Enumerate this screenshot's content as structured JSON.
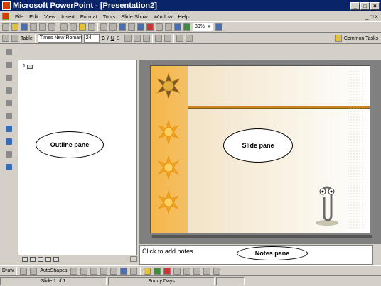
{
  "window": {
    "title": "Microsoft PowerPoint - [Presentation2]",
    "buttons": [
      "_",
      "□",
      "×"
    ]
  },
  "menubar": {
    "items": [
      "File",
      "Edit",
      "View",
      "Insert",
      "Format",
      "Tools",
      "Slide Show",
      "Window",
      "Help"
    ],
    "doc_buttons": [
      "_",
      "□",
      "×"
    ]
  },
  "standard_toolbar": {
    "zoom": "39%"
  },
  "formatting_toolbar": {
    "table_label": "Table",
    "font": "Times New Roman",
    "size": "24",
    "bold": "B",
    "italic": "I",
    "underline": "U",
    "shadow": "S",
    "common_tasks": "Common Tasks"
  },
  "outline_pane": {
    "slide_number": "1",
    "callout": "Outline pane"
  },
  "slide_pane": {
    "callout": "Slide pane"
  },
  "notes_pane": {
    "placeholder": "Click to add notes",
    "callout": "Notes pane"
  },
  "drawing_toolbar": {
    "draw_label": "Draw",
    "autoshapes_label": "AutoShapes"
  },
  "statusbar": {
    "slide_info": "Slide 1 of 1",
    "design": "Sunny Days"
  },
  "colors": {
    "titlebar": "#0a246a",
    "slide_stripe": "#f6b64a",
    "slide_bar": "#c9861f"
  }
}
